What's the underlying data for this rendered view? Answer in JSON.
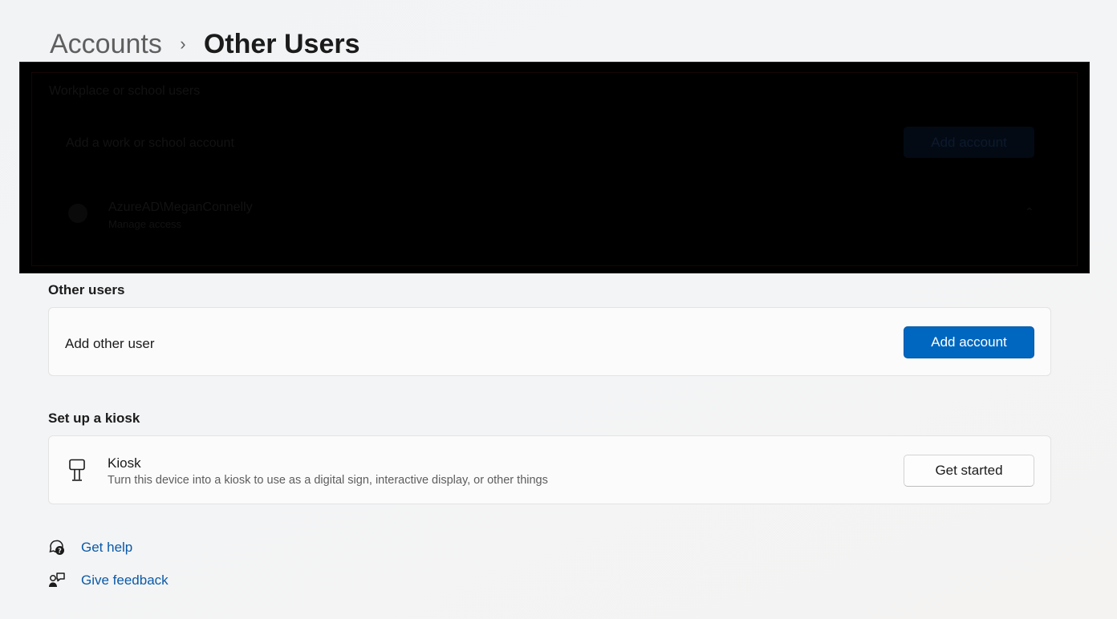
{
  "breadcrumb": {
    "parent": "Accounts",
    "separator": "›",
    "current": "Other Users"
  },
  "obscured_section": {
    "title": "Workplace or school users",
    "add_label": "Add a work or school account",
    "button_label": "Add account",
    "account_name": "AzureAD\\MeganConnelly",
    "account_sub": "Manage access"
  },
  "other_users": {
    "title": "Other users",
    "add_label": "Add other user",
    "button_label": "Add account"
  },
  "kiosk": {
    "section_title": "Set up a kiosk",
    "title": "Kiosk",
    "description": "Turn this device into a kiosk to use as a digital sign, interactive display, or other things",
    "button_label": "Get started",
    "icon": "kiosk-icon"
  },
  "links": {
    "help": {
      "label": "Get help",
      "icon": "help-icon"
    },
    "feedback": {
      "label": "Give feedback",
      "icon": "feedback-icon"
    }
  },
  "colors": {
    "accent": "#0067c0",
    "link": "#0a5aa8",
    "overlay": "#000000"
  }
}
